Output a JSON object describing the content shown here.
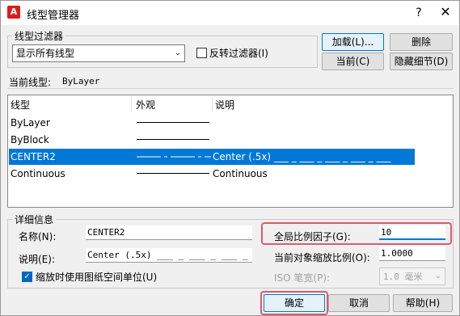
{
  "window": {
    "title": "线型管理器",
    "help_glyph": "?",
    "close_glyph": "✕"
  },
  "filter": {
    "group_label": "线型过滤器",
    "selected": "显示所有线型",
    "invert_label": "反转过滤器(I)",
    "invert_checked": false
  },
  "buttons": {
    "load": "加载(L)...",
    "delete": "删除",
    "current": "当前(C)",
    "hide_details": "隐藏细节(D)",
    "ok": "确定",
    "cancel": "取消",
    "help": "帮助(H)"
  },
  "current_linetype": {
    "label": "当前线型:",
    "value": "ByLayer"
  },
  "table": {
    "headers": [
      "线型",
      "外观",
      "说明"
    ],
    "rows": [
      {
        "name": "ByLayer",
        "appearance": "solid",
        "description": "",
        "selected": false
      },
      {
        "name": "ByBlock",
        "appearance": "solid",
        "description": "",
        "selected": false
      },
      {
        "name": "CENTER2",
        "appearance": "center",
        "description": "Center (.5x) ___ _ ___ _ ___ _ ___ _ ___",
        "selected": true
      },
      {
        "name": "Continuous",
        "appearance": "solid",
        "description": "Continuous",
        "selected": false
      }
    ]
  },
  "details": {
    "group_label": "详细信息",
    "name_label": "名称(N):",
    "name_value": "CENTER2",
    "desc_label": "说明(E):",
    "desc_value": "Center (.5x) ___ _ ___ _ ___ _",
    "paperspace_label": "缩放时使用图纸空间单位(U)",
    "paperspace_checked": true,
    "global_scale_label": "全局比例因子(G):",
    "global_scale_value": "10",
    "current_scale_label": "当前对象缩放比例(O):",
    "current_scale_value": "1.0000",
    "iso_label": "ISO 笔宽(P):",
    "iso_value": "1.0 毫米"
  },
  "colors": {
    "accent": "#0078d7",
    "highlight_outline": "#e05a6a"
  }
}
